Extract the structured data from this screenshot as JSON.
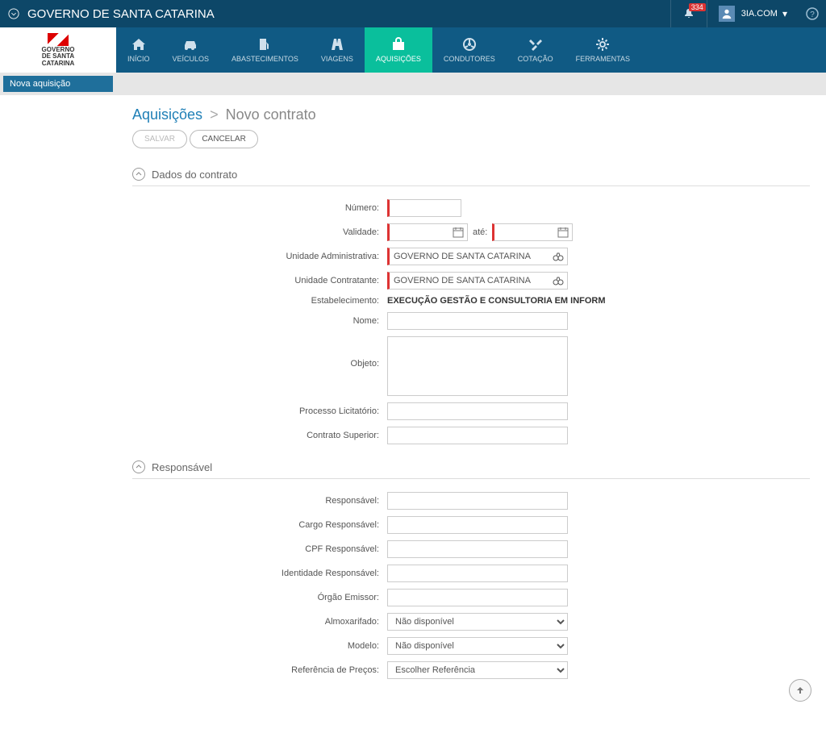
{
  "header": {
    "title": "GOVERNO DE SANTA CATARINA",
    "notif_count": "334",
    "user": "3IA.COM"
  },
  "logo": {
    "line1": "GOVERNO",
    "line2": "DE SANTA",
    "line3": "CATARINA"
  },
  "tabs": {
    "inicio": "INÍCIO",
    "veiculos": "VEÍCULOS",
    "abastecimentos": "ABASTECIMENTOS",
    "viagens": "VIAGENS",
    "aquisicoes": "AQUISIÇÕES",
    "condutores": "CONDUTORES",
    "cotacao": "COTAÇÃO",
    "ferramentas": "FERRAMENTAS"
  },
  "sidebar": {
    "item0": "Nova aquisição"
  },
  "breadcrumb": {
    "root": "Aquisições",
    "sep": ">",
    "current": "Novo contrato"
  },
  "buttons": {
    "save": "SALVAR",
    "cancel": "CANCELAR"
  },
  "sections": {
    "dados": "Dados do contrato",
    "resp": "Responsável"
  },
  "labels": {
    "numero": "Número:",
    "validade": "Validade:",
    "ate": "até:",
    "uadm": "Unidade Administrativa:",
    "ucon": "Unidade Contratante:",
    "estab": "Estabelecimento:",
    "nome": "Nome:",
    "objeto": "Objeto:",
    "proclic": "Processo Licitatório:",
    "contsup": "Contrato Superior:",
    "responsavel": "Responsável:",
    "cargo": "Cargo Responsável:",
    "cpf": "CPF Responsável:",
    "ident": "Identidade Responsável:",
    "orgao": "Órgão Emissor:",
    "almox": "Almoxarifado:",
    "modelo": "Modelo:",
    "refprecos": "Referência de Preços:"
  },
  "values": {
    "uadm": "GOVERNO DE SANTA CATARINA",
    "ucon": "GOVERNO DE SANTA CATARINA",
    "estab": "EXECUÇÃO GESTÃO E CONSULTORIA EM INFORM",
    "almox": "Não disponível",
    "modelo": "Não disponível",
    "refprecos": "Escolher Referência"
  }
}
